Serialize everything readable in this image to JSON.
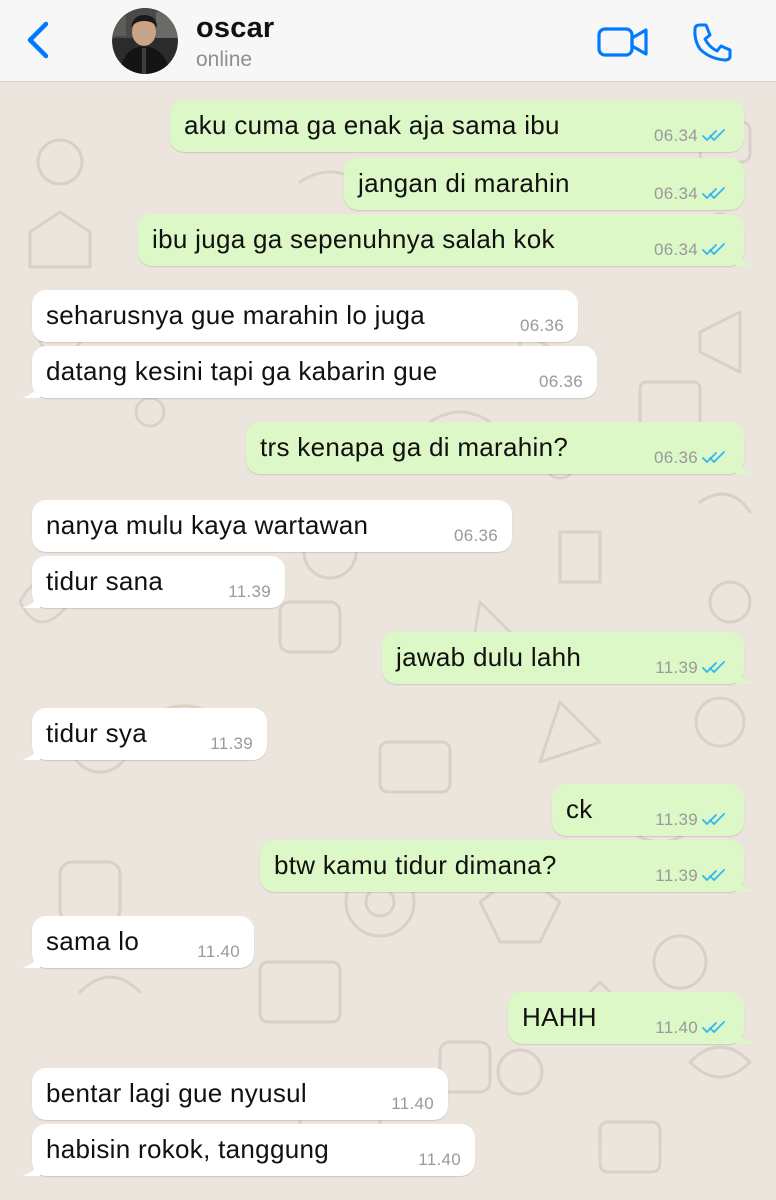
{
  "header": {
    "contact_name": "oscar",
    "status": "online"
  },
  "colors": {
    "accent": "#007aff",
    "outgoing_bubble": "#dcf8c6",
    "incoming_bubble": "#ffffff",
    "chat_background": "#ece5dd",
    "read_ticks": "#34b7f1"
  },
  "icons": {
    "back": "chevron-left-icon",
    "video": "video-camera-icon",
    "call": "phone-icon",
    "read_status": "double-check-icon"
  },
  "messages": [
    {
      "direction": "out",
      "text": "aku cuma ga enak aja sama ibu",
      "time": "06.34",
      "read": true
    },
    {
      "direction": "out",
      "text": "jangan di marahin",
      "time": "06.34",
      "read": true
    },
    {
      "direction": "out",
      "text": "ibu juga ga sepenuhnya salah kok",
      "time": "06.34",
      "read": true
    },
    {
      "direction": "in",
      "text": "seharusnya gue marahin lo juga",
      "time": "06.36"
    },
    {
      "direction": "in",
      "text": "datang kesini tapi ga kabarin gue",
      "time": "06.36"
    },
    {
      "direction": "out",
      "text": "trs kenapa ga di marahin?",
      "time": "06.36",
      "read": true
    },
    {
      "direction": "in",
      "text": "nanya mulu kaya wartawan",
      "time": "06.36"
    },
    {
      "direction": "in",
      "text": "tidur sana",
      "time": "11.39"
    },
    {
      "direction": "out",
      "text": "jawab dulu lahh",
      "time": "11.39",
      "read": true
    },
    {
      "direction": "in",
      "text": "tidur sya",
      "time": "11.39"
    },
    {
      "direction": "out",
      "text": "ck",
      "time": "11.39",
      "read": true
    },
    {
      "direction": "out",
      "text": "btw kamu tidur dimana?",
      "time": "11.39",
      "read": true
    },
    {
      "direction": "in",
      "text": "sama lo",
      "time": "11.40"
    },
    {
      "direction": "out",
      "text": "HAHH",
      "time": "11.40",
      "read": true
    },
    {
      "direction": "in",
      "text": "bentar lagi gue nyusul",
      "time": "11.40"
    },
    {
      "direction": "in",
      "text": "habisin rokok, tanggung",
      "time": "11.40"
    }
  ]
}
